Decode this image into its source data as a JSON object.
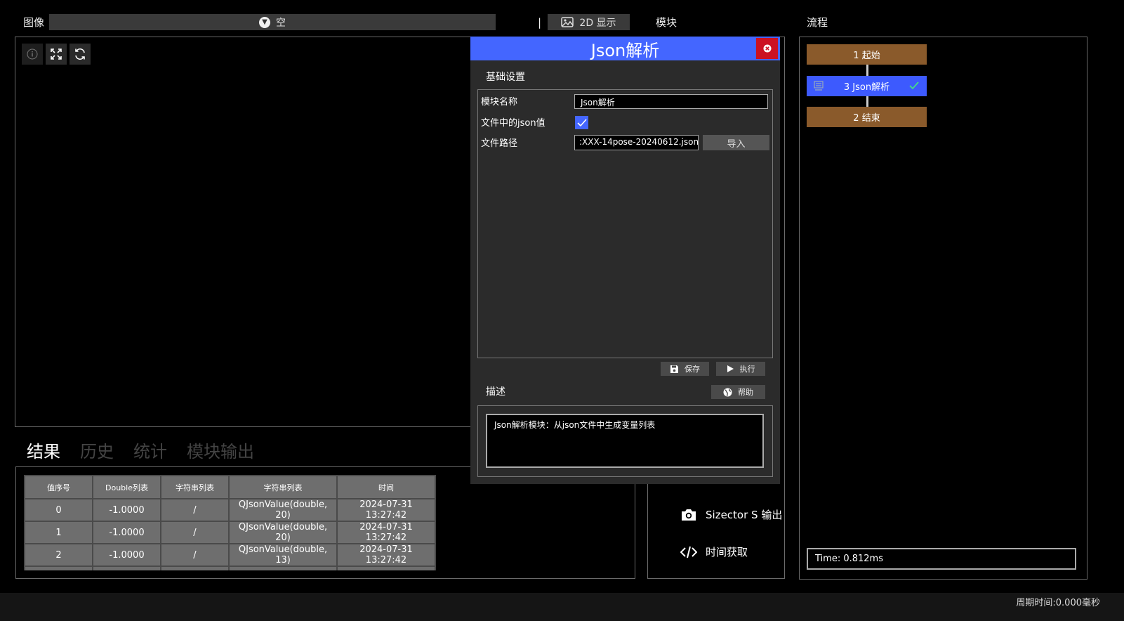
{
  "image_bar": {
    "label": "图像",
    "combo_value": "空",
    "separator": "|",
    "display_button": "2D 显示"
  },
  "modules_label": "模块",
  "flow_label": "流程",
  "result_tabs": [
    "结果",
    "历史",
    "统计",
    "模块输出"
  ],
  "table": {
    "headers": [
      "值序号",
      "Double列表",
      "字符串列表",
      "字符串列表",
      "时间"
    ],
    "rows": [
      [
        "0",
        "-1.0000",
        "/",
        "QJsonValue(double, 20)",
        "2024-07-31 13:27:42"
      ],
      [
        "1",
        "-1.0000",
        "/",
        "QJsonValue(double, 20)",
        "2024-07-31 13:27:42"
      ],
      [
        "2",
        "-1.0000",
        "/",
        "QJsonValue(double, 13)",
        "2024-07-31 13:27:42"
      ]
    ]
  },
  "dialog": {
    "title": "Json解析",
    "section_basic": "基础设置",
    "field_name_label": "模块名称",
    "field_name_value": "Json解析",
    "json_checkbox_label": "文件中的json值",
    "json_checked": true,
    "file_path_label": "文件路径",
    "file_path_value": ":XXX-14pose-20240612.json",
    "import_button": "导入",
    "save_button": "保存",
    "run_button": "执行",
    "section_desc": "描述",
    "help_button": "帮助",
    "description": "Json解析模块：从json文件中生成变量列表"
  },
  "module_list": [
    {
      "label": "Sizector S 输出",
      "icon": "camera-icon"
    },
    {
      "label": "时间获取",
      "icon": "code-icon"
    }
  ],
  "flow": {
    "nodes": [
      {
        "label": "1 起始",
        "color": "#8a5a2b"
      },
      {
        "label": "3 Json解析",
        "color": "#3d5afe",
        "active": true
      },
      {
        "label": "2 结束",
        "color": "#8a5a2b"
      }
    ],
    "time_text": "Time: 0.812ms"
  },
  "status_bar": {
    "cycle_time": "周期时间:0.000毫秒"
  },
  "colors": {
    "accent": "#4466ff",
    "node_brown": "#8a5a2b",
    "close_red": "#cc1122",
    "check_green": "#44dd88"
  }
}
